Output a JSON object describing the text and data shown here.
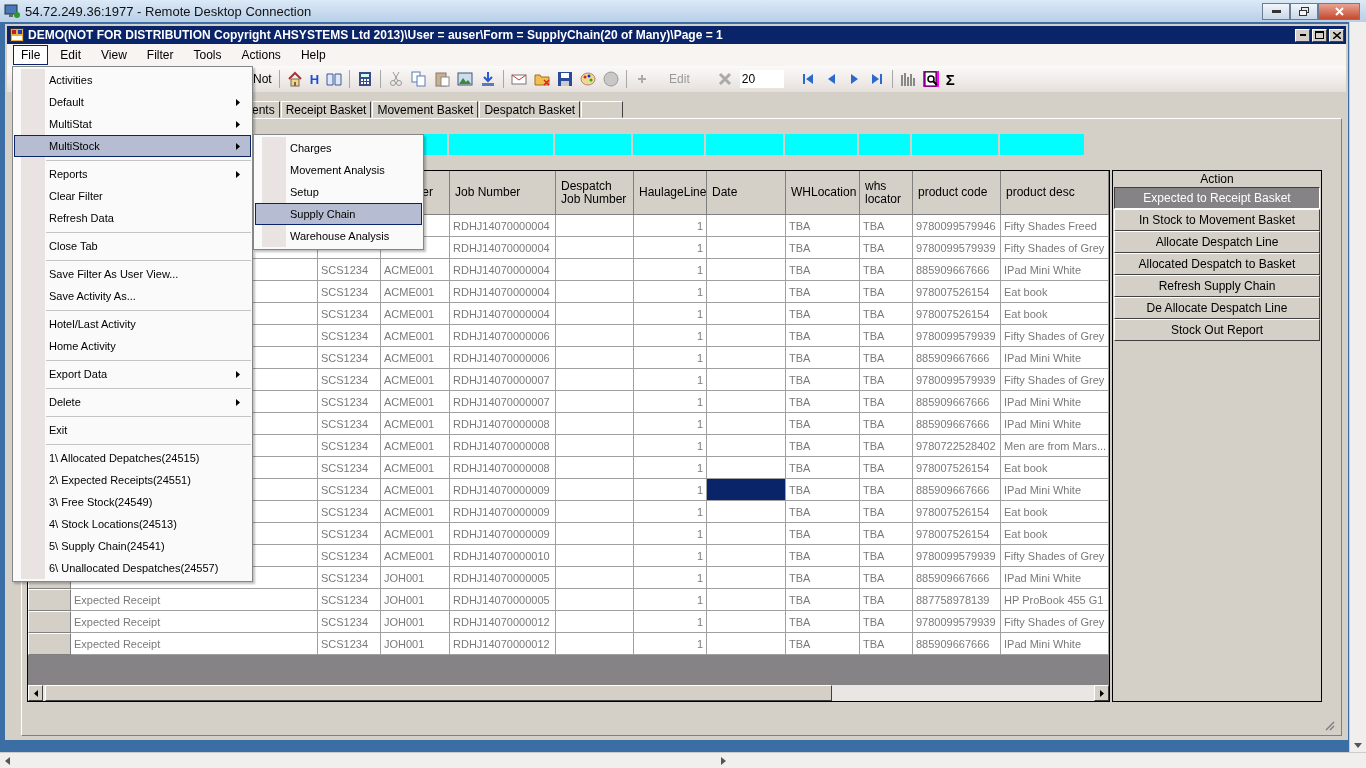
{
  "remote_desktop": {
    "title": "54.72.249.36:1977 - Remote Desktop Connection"
  },
  "window": {
    "title": "DEMO(NOT FOR DISTRIBUTION Copyright AHSYSTEMS Ltd 2013)\\User = auser\\Form = SupplyChain(20 of Many)\\Page = 1"
  },
  "menu_bar": [
    {
      "label": "File",
      "selected": true
    },
    {
      "label": "Edit",
      "selected": false
    },
    {
      "label": "View",
      "selected": false
    },
    {
      "label": "Filter",
      "selected": false
    },
    {
      "label": "Tools",
      "selected": false
    },
    {
      "label": "Actions",
      "selected": false
    },
    {
      "label": "Help",
      "selected": false
    }
  ],
  "toolbar": {
    "filter_label": "Not",
    "history_glyph": "H",
    "edit": {
      "label": "Edit",
      "disabled": true
    },
    "page_size": "20",
    "sum_glyph": "Σ"
  },
  "tabs": [
    {
      "label": "ents",
      "selected": false
    },
    {
      "label": "Receipt Basket",
      "selected": false
    },
    {
      "label": "Movement Basket",
      "selected": false
    },
    {
      "label": "Despatch Basket",
      "selected": false
    },
    {
      "selected": false
    }
  ],
  "table": {
    "columns": [
      null,
      null,
      null,
      "er",
      "Job Number",
      "Despatch Job Number",
      "HaulageLine",
      "Date",
      "WHLocation",
      "whs locator",
      "product code",
      "product desc"
    ],
    "rows": [
      {
        "cells": [
          null,
          null,
          null,
          null,
          "RDHJ14070000004",
          null,
          "1",
          null,
          "TBA",
          "TBA",
          "9780099579946",
          "Fifty Shades Freed"
        ],
        "date_selected": false
      },
      {
        "cells": [
          null,
          null,
          null,
          null,
          "RDHJ14070000004",
          null,
          "1",
          null,
          "TBA",
          "TBA",
          "9780099579939",
          "Fifty Shades of Grey"
        ],
        "date_selected": false
      },
      {
        "cells": [
          null,
          null,
          "SCS1234",
          "ACME001",
          "RDHJ14070000004",
          null,
          "1",
          null,
          "TBA",
          "TBA",
          "885909667666",
          "IPad Mini White"
        ],
        "date_selected": false
      },
      {
        "cells": [
          null,
          null,
          "SCS1234",
          "ACME001",
          "RDHJ14070000004",
          null,
          "1",
          null,
          "TBA",
          "TBA",
          "978007526154",
          "Eat book"
        ],
        "date_selected": false
      },
      {
        "cells": [
          null,
          null,
          "SCS1234",
          "ACME001",
          "RDHJ14070000004",
          null,
          "1",
          null,
          "TBA",
          "TBA",
          "978007526154",
          "Eat book"
        ],
        "date_selected": false
      },
      {
        "cells": [
          null,
          null,
          "SCS1234",
          "ACME001",
          "RDHJ14070000006",
          null,
          "1",
          null,
          "TBA",
          "TBA",
          "9780099579939",
          "Fifty Shades of Grey"
        ],
        "date_selected": false
      },
      {
        "cells": [
          null,
          null,
          "SCS1234",
          "ACME001",
          "RDHJ14070000006",
          null,
          "1",
          null,
          "TBA",
          "TBA",
          "885909667666",
          "IPad Mini White"
        ],
        "date_selected": false
      },
      {
        "cells": [
          null,
          null,
          "SCS1234",
          "ACME001",
          "RDHJ14070000007",
          null,
          "1",
          null,
          "TBA",
          "TBA",
          "9780099579939",
          "Fifty Shades of Grey"
        ],
        "date_selected": false
      },
      {
        "cells": [
          null,
          null,
          "SCS1234",
          "ACME001",
          "RDHJ14070000007",
          null,
          "1",
          null,
          "TBA",
          "TBA",
          "885909667666",
          "IPad Mini White"
        ],
        "date_selected": false
      },
      {
        "cells": [
          null,
          null,
          "SCS1234",
          "ACME001",
          "RDHJ14070000008",
          null,
          "1",
          null,
          "TBA",
          "TBA",
          "885909667666",
          "IPad Mini White"
        ],
        "date_selected": false
      },
      {
        "cells": [
          null,
          null,
          "SCS1234",
          "ACME001",
          "RDHJ14070000008",
          null,
          "1",
          null,
          "TBA",
          "TBA",
          "9780722528402",
          "Men are from Mars..."
        ],
        "date_selected": false
      },
      {
        "cells": [
          null,
          null,
          "SCS1234",
          "ACME001",
          "RDHJ14070000008",
          null,
          "1",
          null,
          "TBA",
          "TBA",
          "978007526154",
          "Eat book"
        ],
        "date_selected": false
      },
      {
        "cells": [
          null,
          null,
          "SCS1234",
          "ACME001",
          "RDHJ14070000009",
          null,
          "1",
          null,
          "TBA",
          "TBA",
          "885909667666",
          "IPad Mini White"
        ],
        "date_selected": true
      },
      {
        "cells": [
          null,
          null,
          "SCS1234",
          "ACME001",
          "RDHJ14070000009",
          null,
          "1",
          null,
          "TBA",
          "TBA",
          "978007526154",
          "Eat book"
        ],
        "date_selected": false
      },
      {
        "cells": [
          null,
          null,
          "SCS1234",
          "ACME001",
          "RDHJ14070000009",
          null,
          "1",
          null,
          "TBA",
          "TBA",
          "978007526154",
          "Eat book"
        ],
        "date_selected": false
      },
      {
        "cells": [
          null,
          null,
          "SCS1234",
          "ACME001",
          "RDHJ14070000010",
          null,
          "1",
          null,
          "TBA",
          "TBA",
          "9780099579939",
          "Fifty Shades of Grey"
        ],
        "date_selected": false
      },
      {
        "cells": [
          null,
          null,
          "SCS1234",
          "JOH001",
          "RDHJ14070000005",
          null,
          "1",
          null,
          "TBA",
          "TBA",
          "885909667666",
          "IPad Mini White"
        ],
        "date_selected": false
      },
      {
        "cells": [
          null,
          "Expected Receipt",
          "SCS1234",
          "JOH001",
          "RDHJ14070000005",
          null,
          "1",
          null,
          "TBA",
          "TBA",
          "887758978139",
          "HP ProBook 455 G1"
        ],
        "date_selected": false
      },
      {
        "cells": [
          null,
          "Expected Receipt",
          "SCS1234",
          "JOH001",
          "RDHJ14070000012",
          null,
          "1",
          null,
          "TBA",
          "TBA",
          "9780099579939",
          "Fifty Shades of Grey"
        ],
        "date_selected": false
      },
      {
        "cells": [
          null,
          "Expected Receipt",
          "SCS1234",
          "JOH001",
          "RDHJ14070000012",
          null,
          "1",
          null,
          "TBA",
          "TBA",
          "885909667666",
          "IPad Mini White"
        ],
        "date_selected": false
      }
    ]
  },
  "action_panel": {
    "title": "Action",
    "buttons": [
      {
        "label": "Expected to Receipt Basket",
        "selected": true
      },
      {
        "label": "In Stock to Movement Basket",
        "selected": false
      },
      {
        "label": "Allocate Despatch Line",
        "selected": false
      },
      {
        "label": "Allocated Despatch to Basket",
        "selected": false
      },
      {
        "label": "Refresh Supply Chain",
        "selected": false
      },
      {
        "label": "De Allocate Despatch Line",
        "selected": false
      },
      {
        "label": "Stock Out Report",
        "selected": false
      }
    ]
  },
  "file_menu": {
    "items": [
      {
        "kind": "item",
        "label": "Activities",
        "submenu": false,
        "selected": false
      },
      {
        "kind": "item",
        "label": "Default",
        "submenu": true,
        "selected": false
      },
      {
        "kind": "item",
        "label": "MultiStat",
        "submenu": true,
        "selected": false
      },
      {
        "kind": "item",
        "label": "MultiStock",
        "submenu": true,
        "selected": true
      },
      {
        "kind": "separator"
      },
      {
        "kind": "item",
        "label": "Reports",
        "submenu": true,
        "selected": false
      },
      {
        "kind": "item",
        "label": "Clear Filter",
        "submenu": false,
        "selected": false
      },
      {
        "kind": "item",
        "label": "Refresh Data",
        "submenu": false,
        "selected": false
      },
      {
        "kind": "separator"
      },
      {
        "kind": "item",
        "label": "Close Tab",
        "submenu": false,
        "selected": false
      },
      {
        "kind": "separator"
      },
      {
        "kind": "item",
        "label": "Save Filter As User View...",
        "submenu": false,
        "selected": false
      },
      {
        "kind": "item",
        "label": "Save Activity As...",
        "submenu": false,
        "selected": false
      },
      {
        "kind": "separator"
      },
      {
        "kind": "item",
        "label": "Hotel/Last Activity",
        "submenu": false,
        "selected": false
      },
      {
        "kind": "item",
        "label": "Home Activity",
        "submenu": false,
        "selected": false
      },
      {
        "kind": "separator"
      },
      {
        "kind": "item",
        "label": "Export Data",
        "submenu": true,
        "selected": false
      },
      {
        "kind": "separator"
      },
      {
        "kind": "item",
        "label": "Delete",
        "submenu": true,
        "selected": false
      },
      {
        "kind": "separator"
      },
      {
        "kind": "item",
        "label": "Exit",
        "submenu": false,
        "selected": false
      },
      {
        "kind": "separator"
      },
      {
        "kind": "item",
        "label": "1\\ Allocated Depatches(24515)",
        "submenu": false,
        "selected": false
      },
      {
        "kind": "item",
        "label": "2\\ Expected Receipts(24551)",
        "submenu": false,
        "selected": false
      },
      {
        "kind": "item",
        "label": "3\\ Free Stock(24549)",
        "submenu": false,
        "selected": false
      },
      {
        "kind": "item",
        "label": "4\\ Stock Locations(24513)",
        "submenu": false,
        "selected": false
      },
      {
        "kind": "item",
        "label": "5\\ Supply Chain(24541)",
        "submenu": false,
        "selected": false
      },
      {
        "kind": "item",
        "label": "6\\ Unallocated Despatches(24557)",
        "submenu": false,
        "selected": false
      }
    ]
  },
  "multistock_submenu": {
    "items": [
      {
        "kind": "item",
        "label": "Charges",
        "submenu": false,
        "selected": false
      },
      {
        "kind": "item",
        "label": "Movement Analysis",
        "submenu": false,
        "selected": false
      },
      {
        "kind": "item",
        "label": "Setup",
        "submenu": false,
        "selected": false
      },
      {
        "kind": "item",
        "label": "Supply Chain",
        "submenu": false,
        "selected": true
      },
      {
        "kind": "item",
        "label": "Warehouse Analysis",
        "submenu": false,
        "selected": false
      }
    ]
  }
}
